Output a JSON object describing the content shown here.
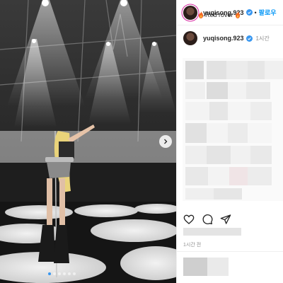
{
  "post": {
    "username": "yuqisong.923",
    "follow_label": "팔로우",
    "separator": "•",
    "caption_time": "1시간",
    "caption_text": "Red rover",
    "time_ago": "1시간 전"
  },
  "carousel": {
    "slide_count": 6,
    "active_index": 0
  },
  "colors": {
    "accent": "#0095f6",
    "verified": "#3897f0",
    "text": "#262626",
    "muted": "#8e8e8e",
    "fire": "#f26722"
  },
  "icons": [
    "verified-icon",
    "fire-icon",
    "heart-icon",
    "comment-icon",
    "share-icon",
    "chevron-right-icon"
  ]
}
